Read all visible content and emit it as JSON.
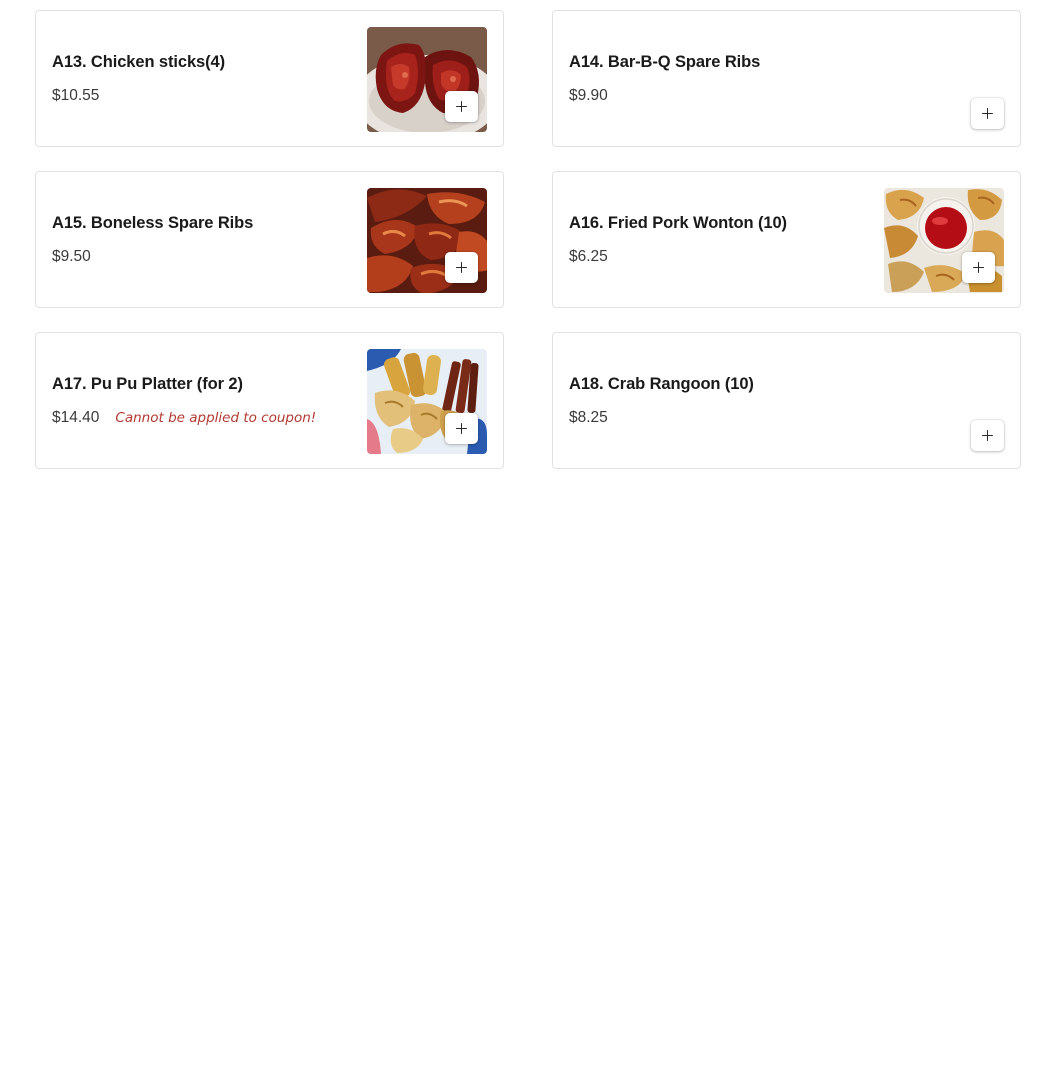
{
  "menu": {
    "items": [
      {
        "name": "A13. Chicken sticks(4)",
        "price": "$10.55",
        "photo": "chicken-sticks-photo",
        "add_icon": "plus-icon"
      },
      {
        "name": "A14. Bar-B-Q Spare Ribs",
        "price": "$9.90",
        "add_icon": "plus-icon"
      },
      {
        "name": "A15. Boneless Spare Ribs",
        "price": "$9.50",
        "photo": "boneless-spare-ribs-photo",
        "add_icon": "plus-icon"
      },
      {
        "name": "A16. Fried Pork Wonton (10)",
        "price": "$6.25",
        "photo": "fried-pork-wonton-photo",
        "add_icon": "plus-icon"
      },
      {
        "name": "A17. Pu Pu Platter (for 2)",
        "price": "$14.40",
        "note": "Cannot be applied to coupon!",
        "photo": "pu-pu-platter-photo",
        "add_icon": "plus-icon"
      },
      {
        "name": "A18. Crab Rangoon (10)",
        "price": "$8.25",
        "add_icon": "plus-icon"
      }
    ]
  },
  "colors": {
    "text": "#1a1a1a",
    "price": "#3a3a3a",
    "note": "#b33a32",
    "card_border": "#e2e2e2",
    "background": "#ffffff"
  }
}
